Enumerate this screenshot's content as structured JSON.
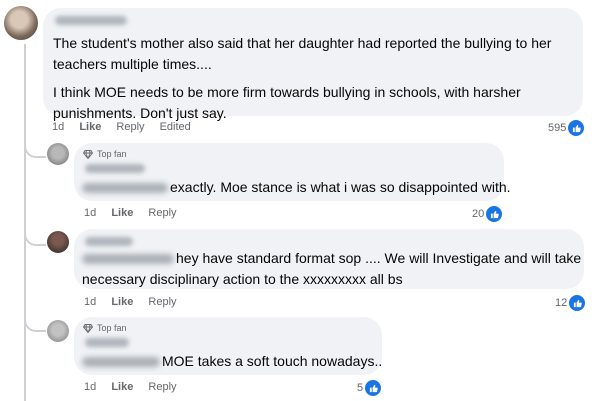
{
  "comments": [
    {
      "text_lines": [
        "The student's mother also said that her daughter had reported the bullying to her",
        "teachers multiple times....",
        "I think MOE needs to be more firm towards bullying in schools, with harsher",
        "punishments. Don't just say."
      ],
      "time": "1d",
      "like": "Like",
      "reply": "Reply",
      "edited": "Edited",
      "reaction_count": "595"
    },
    {
      "badge": "Top fan",
      "text": "exactly. Moe stance is what i was so disappointed with.",
      "time": "1d",
      "like": "Like",
      "reply": "Reply",
      "reaction_count": "20"
    },
    {
      "text_line1": "hey have standard format sop .... We will Investigate and will take",
      "text_line2": "necessary disciplinary action to the xxxxxxxxx all bs",
      "time": "1d",
      "like": "Like",
      "reply": "Reply",
      "reaction_count": "12"
    },
    {
      "badge": "Top fan",
      "text": "MOE takes a soft touch nowadays..",
      "time": "1d",
      "like": "Like",
      "reply": "Reply",
      "reaction_count": "5"
    }
  ],
  "colors": {
    "bubble": "#f0f2f5",
    "like_blue": "#1b74e4",
    "meta": "#65676b"
  },
  "icons": [
    "like-icon",
    "diamond-icon"
  ]
}
